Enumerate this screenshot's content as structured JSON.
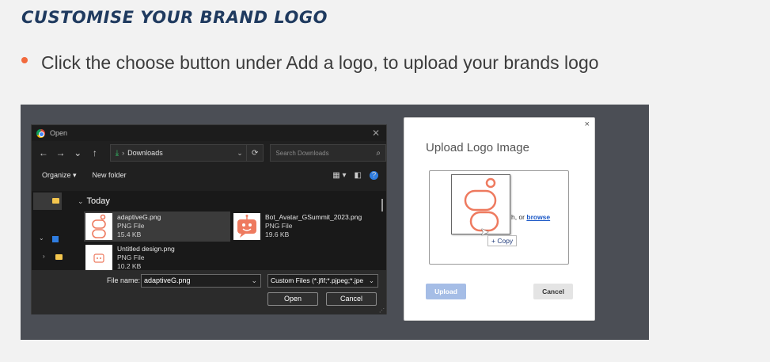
{
  "slide": {
    "title": "CUSTOMISE YOUR BRAND LOGO",
    "bullet": "Click the choose button under Add a logo, to upload your brands logo",
    "accent_color": "#f26a3d",
    "title_color": "#1f3a5f"
  },
  "open_dialog": {
    "title": "Open",
    "close_icon": "✕",
    "nav": {
      "back": "←",
      "forward": "→",
      "recent": "⌄",
      "up": "↑"
    },
    "address": {
      "folder": "Downloads",
      "sep": "›"
    },
    "search_placeholder": "Search Downloads",
    "toolbar": {
      "organize": "Organize ▾",
      "new_folder": "New folder"
    },
    "group": "Today",
    "files": [
      {
        "name": "adaptiveG.png",
        "type": "PNG File",
        "size": "15.4 KB"
      },
      {
        "name": "Bot_Avatar_GSummit_2023.png",
        "type": "PNG File",
        "size": "19.6 KB"
      },
      {
        "name": "Untitled design.png",
        "type": "PNG File",
        "size": "10.2 KB"
      }
    ],
    "filename_label": "File name:",
    "filename_value": "adaptiveG.png",
    "filetype_value": "Custom Files (*.jfif;*.pjpeg;*.jpe",
    "open_label": "Open",
    "cancel_label": "Cancel"
  },
  "upload_modal": {
    "close_icon": "×",
    "title": "Upload Logo Image",
    "drop_prefix": "h, or ",
    "browse_label": "browse",
    "copy_label": "+ Copy",
    "upload_label": "Upload",
    "cancel_label": "Cancel",
    "upload_color": "#a5bde6"
  }
}
